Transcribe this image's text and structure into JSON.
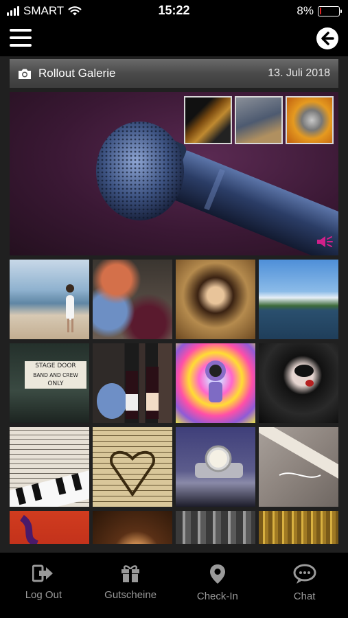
{
  "status_bar": {
    "carrier": "SMART",
    "time": "15:22",
    "battery_percent": "8%",
    "battery_level": 0.08
  },
  "gallery": {
    "title": "Rollout Galerie",
    "date": "13. Juli 2018"
  },
  "hero": {
    "thumbnails": [
      "guitar-thumbnail",
      "guitarist-thumbnail",
      "microphone-thumbnail"
    ]
  },
  "tabs": [
    {
      "label": "Log Out",
      "icon": "logout-icon"
    },
    {
      "label": "Gutscheine",
      "icon": "gift-icon"
    },
    {
      "label": "Check-In",
      "icon": "location-pin-icon"
    },
    {
      "label": "Chat",
      "icon": "chat-bubble-icon"
    }
  ],
  "stage_door_sign": [
    "STAGE DOOR",
    "BAND AND CREW",
    "ONLY"
  ],
  "colors": {
    "accent_pink": "#d0208a",
    "battery_low": "#e02020"
  }
}
